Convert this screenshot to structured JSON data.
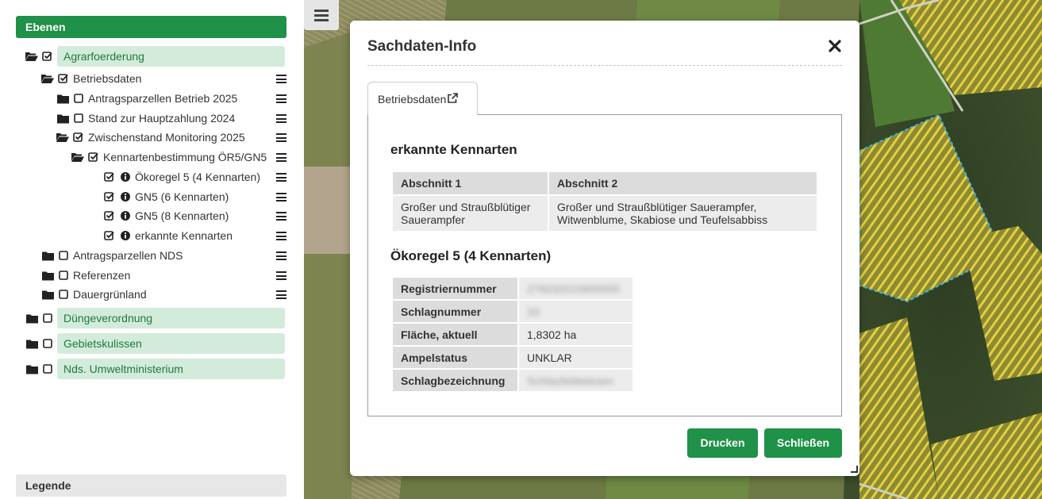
{
  "sidebar": {
    "layers_title": "Ebenen",
    "legend_title": "Legende",
    "tree": {
      "agrar": "Agrarfoerderung",
      "betriebsdaten": "Betriebsdaten",
      "antragsparzellen_2025": "Antragsparzellen Betrieb 2025",
      "stand_hauptzahlung": "Stand zur Hauptzahlung 2024",
      "zwischenstand": "Zwischenstand Monitoring 2025",
      "kennartenbestimmung": "Kennartenbestimmung ÖR5/GN5",
      "oekoregel5": "Ökoregel 5 (4 Kennarten)",
      "gn5_6": "GN5 (6 Kennarten)",
      "gn5_8": "GN5 (8 Kennarten)",
      "erkannte": "erkannte Kennarten",
      "antragsparzellen_nds": "Antragsparzellen NDS",
      "referenzen": "Referenzen",
      "dauergruenland": "Dauergrünland",
      "duengeverordnung": "Düngeverordnung",
      "gebietskulissen": "Gebietskulissen",
      "umweltministerium": "Nds. Umweltministerium"
    }
  },
  "dialog": {
    "title": "Sachdaten-Info",
    "tab_label": "Betriebsdaten",
    "section1_title": "erkannte Kennarten",
    "table1": {
      "headers": [
        "Abschnitt 1",
        "Abschnitt 2"
      ],
      "row": [
        "Großer und Straußblütiger Sauerampfer",
        "Großer und Straußblütiger Sauerampfer, Witwenblume, Skabiose und Teufelsabbiss"
      ]
    },
    "section2_title": "Ökoregel 5 (4 Kennarten)",
    "table2": {
      "rows": [
        {
          "label": "Registriernummer",
          "value": "276032015600000"
        },
        {
          "label": "Schlagnummer",
          "value": "33"
        },
        {
          "label": "Fläche, aktuell",
          "value": "1,8302 ha"
        },
        {
          "label": "Ampelstatus",
          "value": "UNKLAR"
        },
        {
          "label": "Schlagbezeichnung",
          "value": "Schlaufeldwiesen"
        }
      ]
    },
    "print_button": "Drucken",
    "close_button": "Schließen"
  },
  "colors": {
    "brand_green": "#1f9148",
    "group_bg": "#d3ebdb",
    "parcel_highlight": "#e6cf3a",
    "parcel_outline": "#3db4e6"
  },
  "icons": [
    "folder-open-icon",
    "folder-icon",
    "checkbox-checked-icon",
    "checkbox-empty-icon",
    "info-icon",
    "hamburger-icon",
    "close-icon",
    "external-link-icon",
    "resize-handle-icon"
  ]
}
